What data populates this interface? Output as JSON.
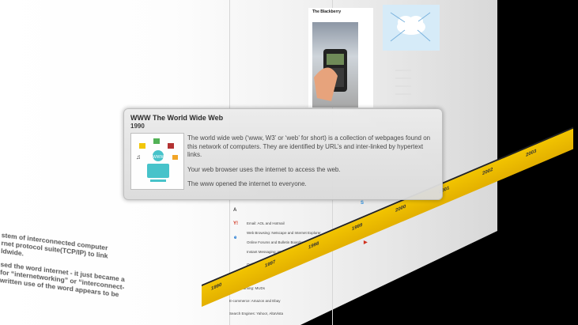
{
  "tooltip": {
    "title": "WWW The World Wide Web",
    "year": "1990",
    "paragraph1": "The world wide web (‘www, W3’ or ‘web’ for short) is a collection of webpages found on this network of computers. They are identified by URL’s and inter-linked by hypertext links.",
    "paragraph2": "Your web browser uses the internet to access the web.",
    "paragraph3": "The www opened the internet to everyone."
  },
  "side_text": {
    "line1": "stem of interconnected computer",
    "line2": "rnet protocol suite(TCP/IP) to link",
    "line3": "ldwide.",
    "line4": "sed the word internet - it just became a",
    "line5": "for “internetworking” or “interconnect-",
    "line6": "written use of the word appears to be"
  },
  "lower_list": {
    "item1": "Email: AOL and Hotmail",
    "item2": "Web Browsing: Netscape and Internet Explorer",
    "item3": "Online Forums and Bulletin Boards: Bulletin board systems",
    "item4": "Instant Messaging: ICQ, AOL Instant Messenger",
    "item5": "Online News and Magazines",
    "item6": "File Sharing and FTP",
    "item7": "Online Gaming: MUDs",
    "item8": "E-commerce: Amazon and Ebay",
    "item9": "Search Engines: Yahoo!, AltaVista"
  },
  "timeline_years": [
    "1990",
    "1997",
    "1998",
    "1999",
    "2000",
    "2001",
    "2002",
    "2003"
  ],
  "colors": {
    "timeline": "#f2c400",
    "tooltip_bg": "#e3e3e3",
    "wall": "#f2f2f2"
  }
}
